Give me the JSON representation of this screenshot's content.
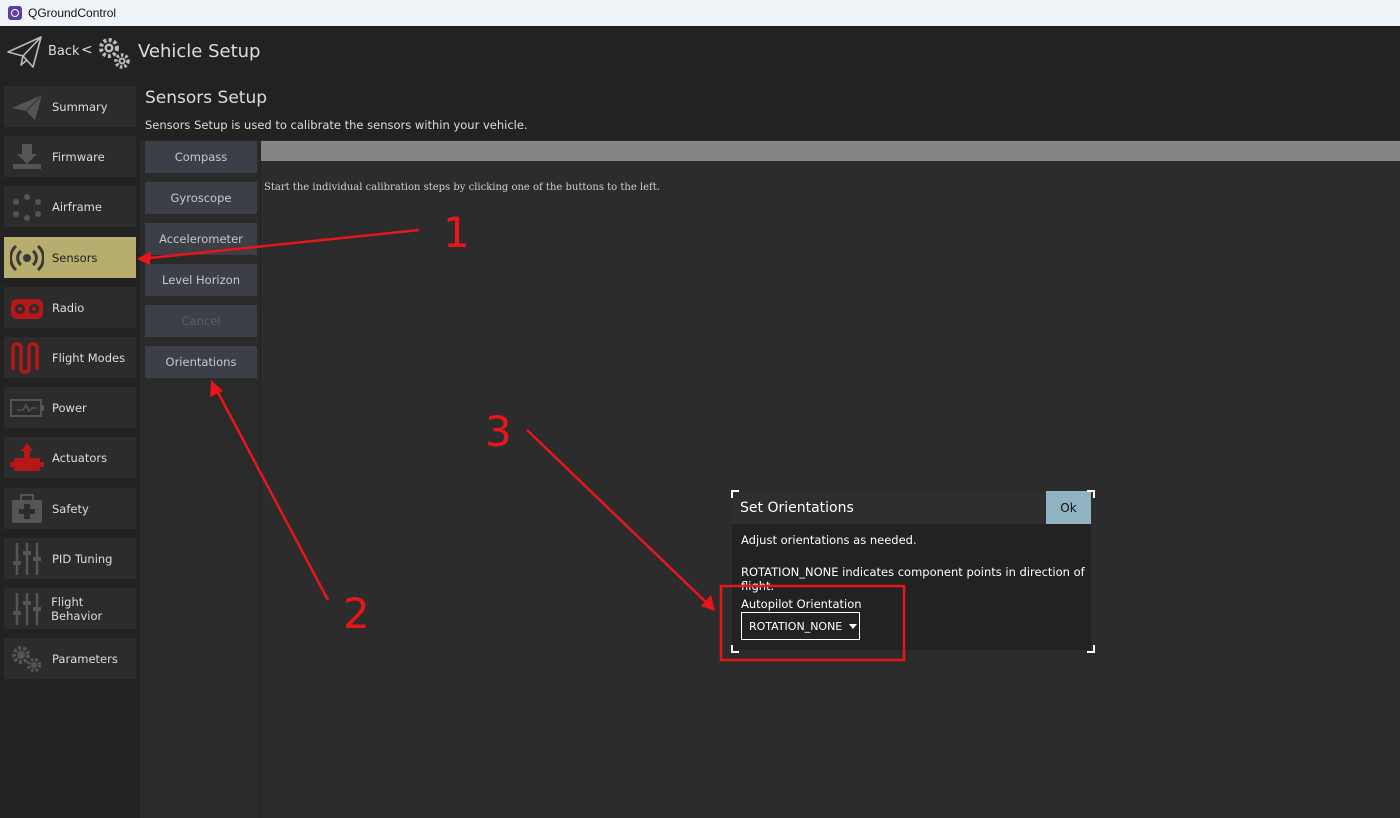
{
  "window": {
    "title": "QGroundControl"
  },
  "toolbar": {
    "back_label": "Back",
    "separator": "<",
    "page_title": "Vehicle Setup"
  },
  "sidebar": {
    "items": [
      {
        "label": "Summary",
        "icon": "paper-plane-icon",
        "active": false
      },
      {
        "label": "Firmware",
        "icon": "download-icon",
        "active": false
      },
      {
        "label": "Airframe",
        "icon": "airframe-icon",
        "active": false
      },
      {
        "label": "Sensors",
        "icon": "sensors-icon",
        "active": true
      },
      {
        "label": "Radio",
        "icon": "radio-icon",
        "active": false
      },
      {
        "label": "Flight Modes",
        "icon": "flight-modes-icon",
        "active": false
      },
      {
        "label": "Power",
        "icon": "battery-icon",
        "active": false
      },
      {
        "label": "Actuators",
        "icon": "actuator-icon",
        "active": false
      },
      {
        "label": "Safety",
        "icon": "first-aid-icon",
        "active": false
      },
      {
        "label": "PID Tuning",
        "icon": "sliders-icon",
        "active": false
      },
      {
        "label": "Flight Behavior",
        "icon": "sliders-icon",
        "active": false
      },
      {
        "label": "Parameters",
        "icon": "gears-icon",
        "active": false
      }
    ]
  },
  "sensors": {
    "title": "Sensors Setup",
    "description": "Sensors Setup is used to calibrate the sensors within your vehicle.",
    "buttons": [
      {
        "label": "Compass",
        "enabled": true
      },
      {
        "label": "Gyroscope",
        "enabled": true
      },
      {
        "label": "Accelerometer",
        "enabled": true
      },
      {
        "label": "Level Horizon",
        "enabled": true
      },
      {
        "label": "Cancel",
        "enabled": false
      },
      {
        "label": "Orientations",
        "enabled": true
      }
    ],
    "instructions": "Start the individual calibration steps by clicking one of the buttons to the left."
  },
  "dialog": {
    "title": "Set Orientations",
    "ok_label": "Ok",
    "text1": "Adjust orientations as needed.",
    "text2": "ROTATION_NONE indicates component points in direction of flight.",
    "field_label": "Autopilot Orientation",
    "field_value": "ROTATION_NONE"
  },
  "annotations": {
    "labels": [
      "1",
      "2",
      "3"
    ],
    "color": "#e8161b"
  },
  "colors": {
    "background": "#222222",
    "active_nav": "#b6ad6e",
    "button": "#3d3f48",
    "ok_button": "#8fb3c1",
    "progress_bar": "#858585"
  }
}
